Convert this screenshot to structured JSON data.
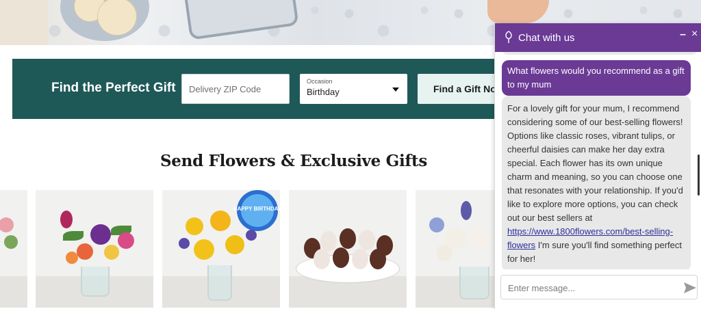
{
  "gift_finder": {
    "title": "Find the Perfect Gift",
    "zip_placeholder": "Delivery ZIP Code",
    "occasion_label": "Occasion",
    "occasion_value": "Birthday",
    "button_label": "Find a Gift Now"
  },
  "section": {
    "title": "Send Flowers & Exclusive Gifts"
  },
  "chat": {
    "title": "Chat with us",
    "minimize": "–",
    "close": "×",
    "user_message": "What flowers would you recommend as a gift to my mum",
    "bot_message_text": "For a lovely gift for your mum, I recommend considering some of our best-selling flowers! Options like classic roses, vibrant tulips, or cheerful daisies can make her day extra special. Each flower has its own unique charm and meaning, so you can choose one that resonates with your relationship. If you'd like to explore more options, you can check out our best sellers at ",
    "bot_message_link": "https://www.1800flowers.com/best-selling-flowers",
    "bot_message_tail": " I'm sure you'll find something perfect for her!",
    "input_placeholder": "Enter message...",
    "header_color": "#6a3a95"
  },
  "colors": {
    "finder_bg": "#1e5958",
    "finder_button_bg": "#e6f3f1"
  },
  "balloon_text": "HAPPY BIRTHDAY"
}
